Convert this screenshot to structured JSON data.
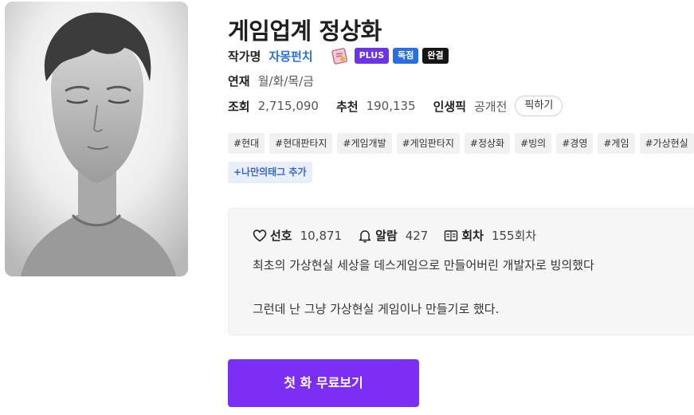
{
  "title": "게임업계 정상화",
  "author": {
    "label": "작가명",
    "name": "자몽펀치"
  },
  "badges": {
    "plus": "PLUS",
    "exclusive": "독점",
    "complete": "완결"
  },
  "serial": {
    "label": "연재",
    "days": "월/화/목/금"
  },
  "stats": {
    "views_label": "조회",
    "views": "2,715,090",
    "recommend_label": "추천",
    "recommend": "190,135",
    "life_pick_label": "인생픽",
    "life_pick_value": "공개전",
    "pick_button": "픽하기"
  },
  "tags": [
    "#현대",
    "#현대판타지",
    "#게임개발",
    "#게임판타지",
    "#정상화",
    "#빙의",
    "#경영",
    "#게임",
    "#가상현실"
  ],
  "add_tag_label": "+나만의태그 추가",
  "meta": {
    "likes_label": "선호",
    "likes": "10,871",
    "alarm_label": "알람",
    "alarm": "427",
    "episodes_label": "회차",
    "episodes": "155회차"
  },
  "description": {
    "line1": "최초의 가상현실 세상을 데스게임으로 만들어버린 개발자로 빙의했다",
    "line2": "그런데 난 그냥 가상현실 게임이나 만들기로 했다."
  },
  "cta_label": "첫 화 무료보기",
  "colors": {
    "accent": "#7b2ff5",
    "link": "#2f6fde",
    "plus_badge": "#6b34e6",
    "exclusive_badge": "#2a6fdd",
    "complete_badge": "#151515"
  }
}
